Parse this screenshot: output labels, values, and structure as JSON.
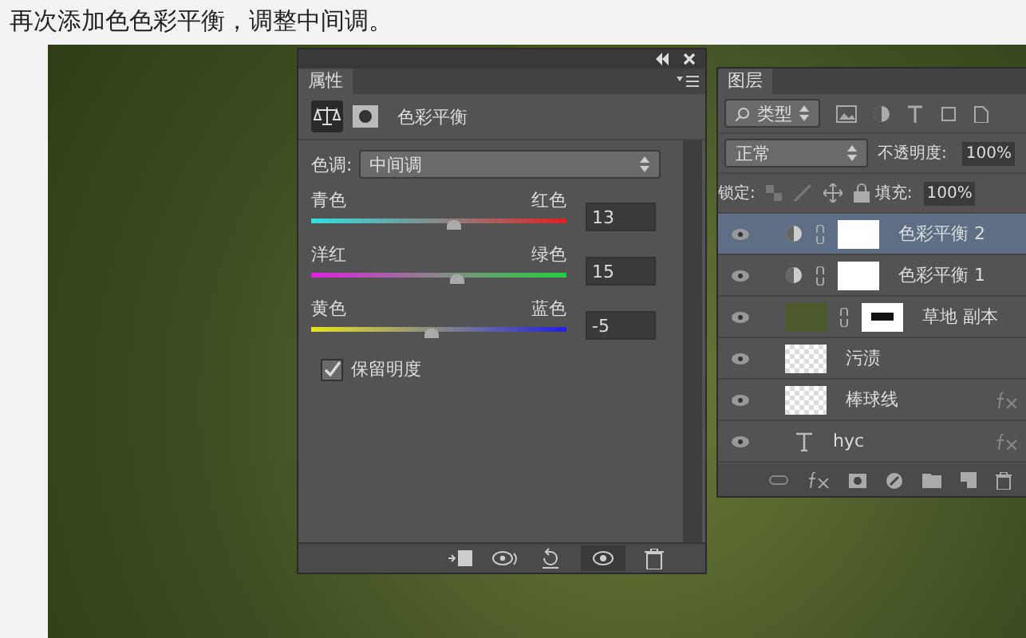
{
  "caption": "再次添加色色彩平衡，调整中间调。",
  "properties": {
    "tab": "属性",
    "title": "色彩平衡",
    "tone_label": "色调:",
    "tone_value": "中间调",
    "sliders": [
      {
        "left": "青色",
        "right": "红色",
        "value": "13",
        "level": 0.565,
        "kind": "cyan-red"
      },
      {
        "left": "洋红",
        "right": "绿色",
        "value": "15",
        "level": 0.575,
        "kind": "magenta-green"
      },
      {
        "left": "黄色",
        "right": "蓝色",
        "value": "-5",
        "level": 0.475,
        "kind": "yellow-blue"
      }
    ],
    "preserve": {
      "label": "保留明度",
      "checked": true
    }
  },
  "layers": {
    "tab": "图层",
    "filter": "类型",
    "blend": "正常",
    "opacity_label": "不透明度:",
    "opacity": "100%",
    "lock_label": "锁定:",
    "fill_label": "填充:",
    "fill": "100%",
    "items": [
      {
        "name": "色彩平衡 2",
        "kind": "adjustment",
        "selected": true,
        "fx": false
      },
      {
        "name": "色彩平衡 1",
        "kind": "adjustment",
        "selected": false,
        "fx": false
      },
      {
        "name": "草地 副本",
        "kind": "masked",
        "selected": false,
        "fx": false
      },
      {
        "name": "污渍",
        "kind": "raster",
        "selected": false,
        "fx": false
      },
      {
        "name": "棒球线",
        "kind": "raster",
        "selected": false,
        "fx": true
      },
      {
        "name": "hyc",
        "kind": "text",
        "selected": false,
        "fx": true
      }
    ]
  }
}
